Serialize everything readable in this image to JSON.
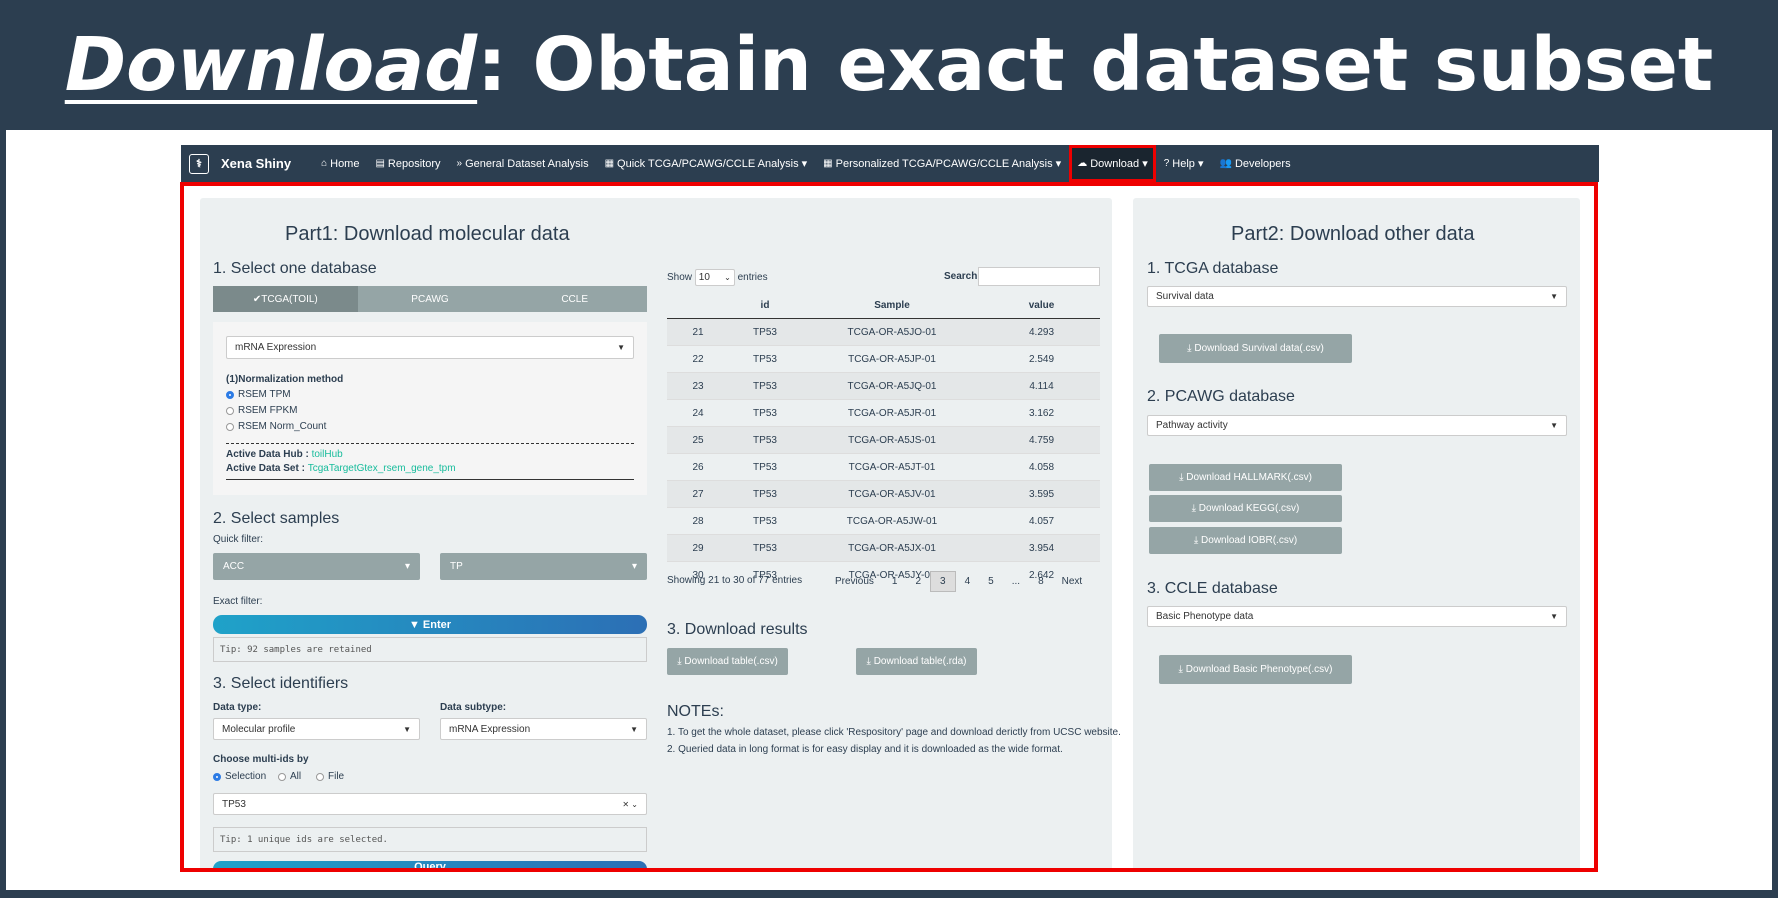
{
  "slide": {
    "title_em": "Download",
    "title_rest": ": Obtain exact dataset subset"
  },
  "nav": {
    "brand": "Xena Shiny",
    "items": [
      {
        "icon": "⌂",
        "label": "Home"
      },
      {
        "icon": "▤",
        "label": "Repository"
      },
      {
        "icon": "»",
        "label": "General Dataset Analysis"
      },
      {
        "icon": "▦",
        "label": "Quick TCGA/PCAWG/CCLE Analysis ▾"
      },
      {
        "icon": "▦",
        "label": "Personalized TCGA/PCAWG/CCLE Analysis ▾"
      },
      {
        "icon": "☁",
        "label": "Download ▾"
      },
      {
        "icon": "?",
        "label": "Help ▾"
      },
      {
        "icon": "👥",
        "label": "Developers"
      }
    ]
  },
  "part1": {
    "title": "Part1: Download molecular data",
    "sec1": "1. Select one database",
    "db_tabs": [
      "✔TCGA(TOIL)",
      "PCAWG",
      "CCLE"
    ],
    "data_select": "mRNA Expression",
    "norm_label": "(1)Normalization method",
    "norm_options": [
      "RSEM TPM",
      "RSEM FPKM",
      "RSEM Norm_Count"
    ],
    "hub_label": "Active Data Hub :",
    "hub_value": "toilHub",
    "set_label": "Active Data Set :",
    "set_value": "TcgaTargetGtex_rsem_gene_tpm",
    "sec2": "2. Select samples",
    "quick_filter": "Quick filter:",
    "filter1": "ACC",
    "filter2": "TP",
    "exact_filter": "Exact filter:",
    "enter": "Enter",
    "tip_samples": "Tip: 92 samples are retained",
    "sec3": "3. Select identifiers",
    "data_type_label": "Data type:",
    "data_type": "Molecular profile",
    "data_subtype_label": "Data subtype:",
    "data_subtype": "mRNA Expression",
    "multi_label": "Choose multi-ids by",
    "multi_opts": [
      "Selection",
      "All",
      "File"
    ],
    "id_value": "TP53",
    "tip_ids": "Tip: 1 unique ids are selected.",
    "query": "Query"
  },
  "table": {
    "show": "Show",
    "entries_val": "10",
    "entries": "entries",
    "search": "Search:",
    "headers": [
      "id",
      "Sample",
      "value"
    ],
    "rows": [
      [
        "21",
        "TP53",
        "TCGA-OR-A5JO-01",
        "4.293"
      ],
      [
        "22",
        "TP53",
        "TCGA-OR-A5JP-01",
        "2.549"
      ],
      [
        "23",
        "TP53",
        "TCGA-OR-A5JQ-01",
        "4.114"
      ],
      [
        "24",
        "TP53",
        "TCGA-OR-A5JR-01",
        "3.162"
      ],
      [
        "25",
        "TP53",
        "TCGA-OR-A5JS-01",
        "4.759"
      ],
      [
        "26",
        "TP53",
        "TCGA-OR-A5JT-01",
        "4.058"
      ],
      [
        "27",
        "TP53",
        "TCGA-OR-A5JV-01",
        "3.595"
      ],
      [
        "28",
        "TP53",
        "TCGA-OR-A5JW-01",
        "4.057"
      ],
      [
        "29",
        "TP53",
        "TCGA-OR-A5JX-01",
        "3.954"
      ],
      [
        "30",
        "TP53",
        "TCGA-OR-A5JY-01",
        "2.642"
      ]
    ],
    "info": "Showing 21 to 30 of 77 entries",
    "pages": [
      "Previous",
      "1",
      "2",
      "3",
      "4",
      "5",
      "...",
      "8",
      "Next"
    ],
    "current_page": "3"
  },
  "results": {
    "title": "3. Download results",
    "btn_csv": "Download table(.csv)",
    "btn_rda": "Download table(.rda)",
    "notes_title": "NOTEs:",
    "note1": "1. To get the whole dataset, please click 'Respository' page and download derictly from UCSC website.",
    "note2": "2. Queried data in long format is for easy display and it is downloaded as the wide format."
  },
  "part2": {
    "title": "Part2: Download other data",
    "tcga_title": "1. TCGA database",
    "tcga_select": "Survival data",
    "tcga_btn": "Download Survival data(.csv)",
    "pcawg_title": "2. PCAWG database",
    "pcawg_select": "Pathway activity",
    "pcawg_btns": [
      "Download HALLMARK(.csv)",
      "Download KEGG(.csv)",
      "Download IOBR(.csv)"
    ],
    "ccle_title": "3. CCLE database",
    "ccle_select": "Basic Phenotype data",
    "ccle_btn": "Download Basic Phenotype(.csv)"
  }
}
